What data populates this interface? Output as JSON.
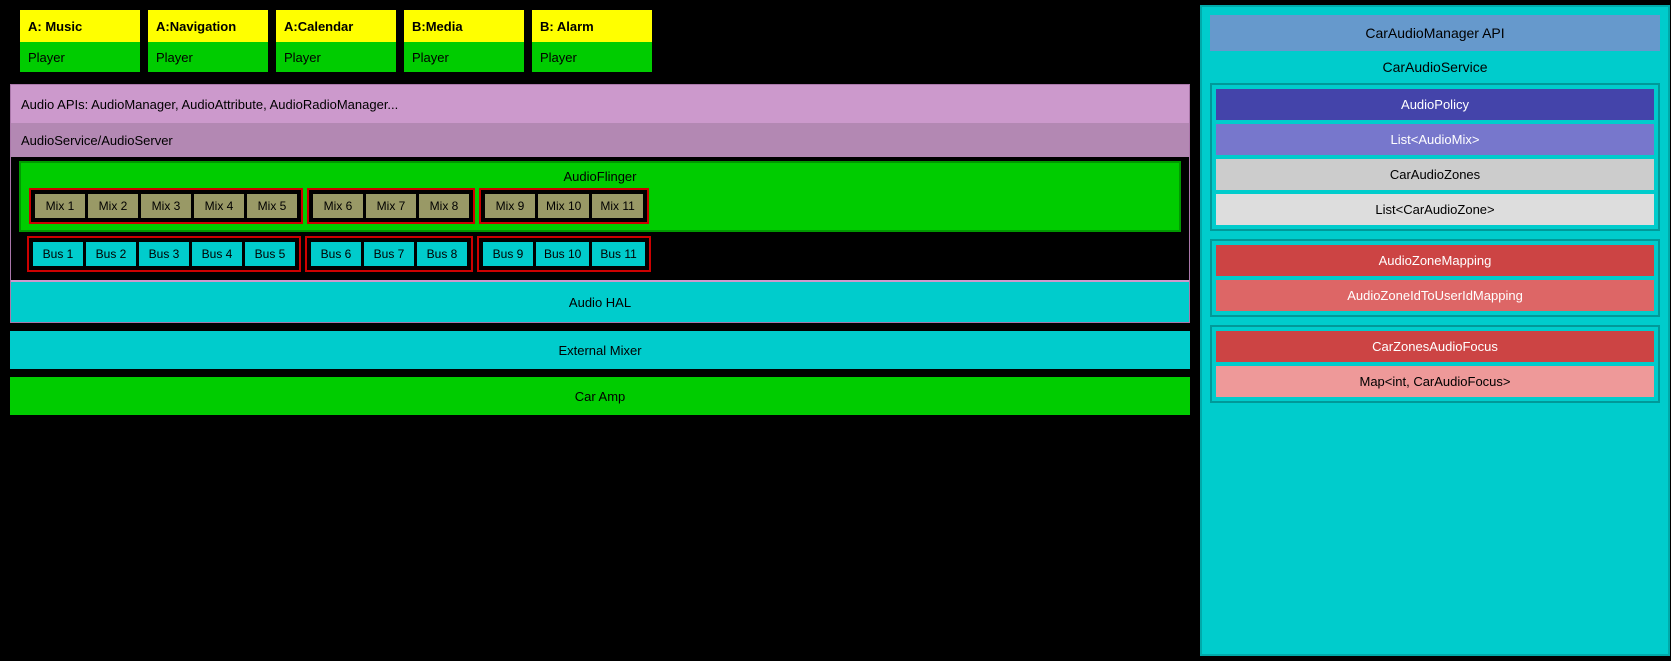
{
  "apps": [
    {
      "label": "A: Music",
      "player": "Player"
    },
    {
      "label": "A:Navigation",
      "player": "Player"
    },
    {
      "label": "A:Calendar",
      "player": "Player"
    },
    {
      "label": "B:Media",
      "player": "Player"
    },
    {
      "label": "B: Alarm",
      "player": "Player"
    }
  ],
  "audioApis": "Audio APIs: AudioManager, AudioAttribute, AudioRadioManager...",
  "audioService": "AudioService/AudioServer",
  "audioFlinger": "AudioFlinger",
  "audioHal": "Audio HAL",
  "externalMixer": "External Mixer",
  "carAmp": "Car Amp",
  "mixGroups": [
    [
      "Mix 1",
      "Mix 2",
      "Mix 3",
      "Mix 4",
      "Mix 5"
    ],
    [
      "Mix 6",
      "Mix 7",
      "Mix 8"
    ],
    [
      "Mix 9",
      "Mix 10",
      "Mix 11"
    ]
  ],
  "busGroups": [
    [
      "Bus 1",
      "Bus 2",
      "Bus 3",
      "Bus 4",
      "Bus 5"
    ],
    [
      "Bus 6",
      "Bus 7",
      "Bus 8"
    ],
    [
      "Bus 9",
      "Bus 10",
      "Bus 11"
    ]
  ],
  "rightPanel": {
    "carAudioManagerApi": "CarAudioManager API",
    "carAudioService": "CarAudioService",
    "audioPolicy": "AudioPolicy",
    "listAudioMix": "List<AudioMix>",
    "carAudioZones": "CarAudioZones",
    "listCarAudioZone": "List<CarAudioZone>",
    "audioZoneMapping": "AudioZoneMapping",
    "audioZoneIdToUserIdMapping": "AudioZoneIdToUserIdMapping",
    "carZonesAudioFocus": "CarZonesAudioFocus",
    "mapCarAudioFocus": "Map<int, CarAudioFocus>"
  }
}
